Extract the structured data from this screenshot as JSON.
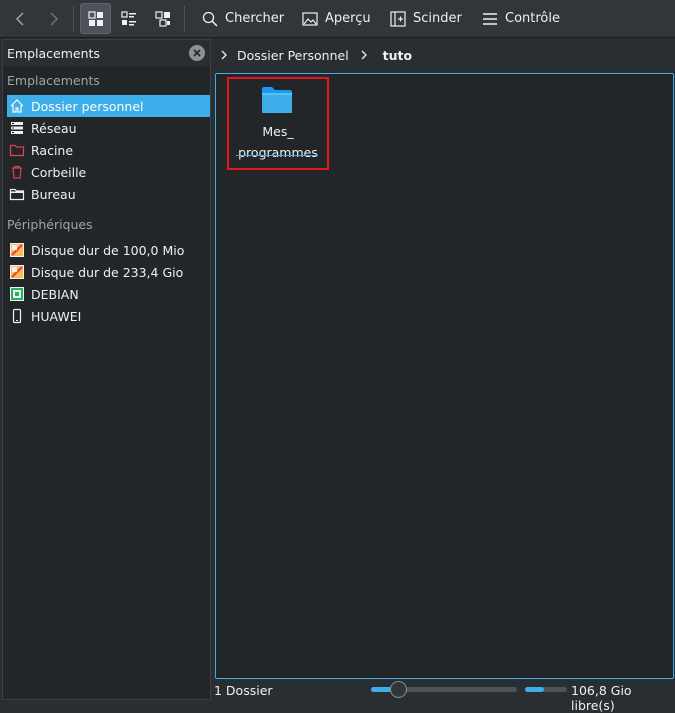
{
  "toolbar": {
    "search_label": "Chercher",
    "preview_label": "Aperçu",
    "split_label": "Scinder",
    "control_label": "Contrôle"
  },
  "sidebar": {
    "title": "Emplacements",
    "places_section": "Emplacements",
    "places": [
      {
        "label": "Dossier personnel",
        "icon": "home-icon",
        "selected": true
      },
      {
        "label": "Réseau",
        "icon": "network-icon"
      },
      {
        "label": "Racine",
        "icon": "root-folder-icon"
      },
      {
        "label": "Corbeille",
        "icon": "trash-icon"
      },
      {
        "label": "Bureau",
        "icon": "desktop-icon"
      }
    ],
    "devices_section": "Périphériques",
    "devices": [
      {
        "label": "Disque dur de 100,0 Mio",
        "icon": "hard-disk-icon"
      },
      {
        "label": "Disque dur de 233,4 Gio",
        "icon": "hard-disk-icon"
      },
      {
        "label": "DEBIAN",
        "icon": "usb-drive-icon"
      },
      {
        "label": "HUAWEI",
        "icon": "phone-icon"
      }
    ]
  },
  "breadcrumb": {
    "items": [
      "Dossier Personnel",
      "tuto"
    ]
  },
  "view": {
    "items": [
      {
        "name_line1": "Mes_",
        "name_line2": "programmes",
        "type": "folder"
      }
    ]
  },
  "statusbar": {
    "info": "1 Dossier",
    "zoom_level": 0.1,
    "disk_used_fraction": 0.45,
    "free_space": "106,8 Gio libre(s)"
  },
  "colors": {
    "accent": "#3daee9",
    "highlight_box": "#e5161c",
    "background": "#2a2e32",
    "panel": "#232629"
  }
}
